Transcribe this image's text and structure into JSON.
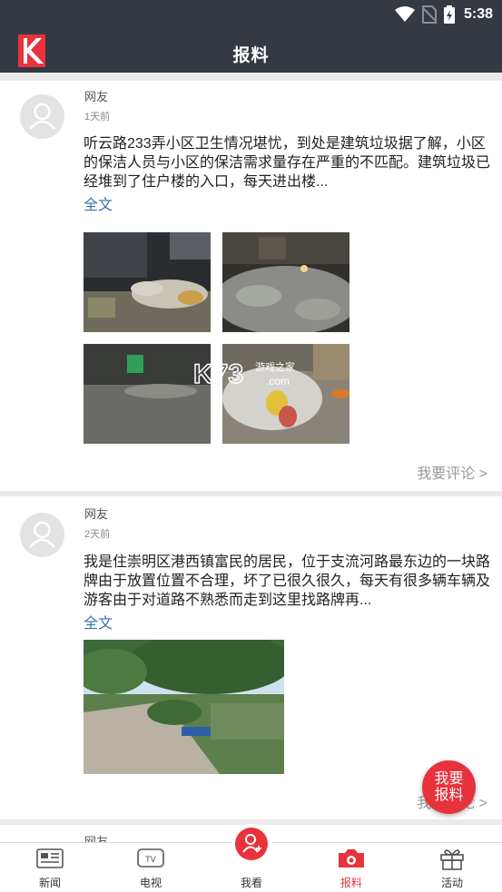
{
  "status_bar": {
    "time": "5:38"
  },
  "header": {
    "title": "报料"
  },
  "posts": [
    {
      "username": "网友",
      "time": "1天前",
      "text": "听云路233弄小区卫生情况堪忧，到处是建筑垃圾据了解，小区的保洁人员与小区的保洁需求量存在严重的不匹配。建筑垃圾已经堆到了住户楼的入口，每天进出楼...",
      "fulltext": "全文",
      "comment": "我要评论 >"
    },
    {
      "username": "网友",
      "time": "2天前",
      "text": "我是住崇明区港西镇富民的居民，位于支流河路最东边的一块路牌由于放置位置不合理，坏了已很久很久，每天有很多辆车辆及游客由于对道路不熟悉而走到这里找路牌再...",
      "fulltext": "全文",
      "comment": "我要评论 >"
    },
    {
      "username": "网友"
    }
  ],
  "watermark": {
    "brand": "K73",
    "tag": "游戏之家",
    "domain": ".com"
  },
  "fab": {
    "line1": "我要",
    "line2": "报料"
  },
  "tabs": [
    {
      "label": "新闻",
      "icon": "newspaper-icon"
    },
    {
      "label": "电视",
      "icon": "tv-icon"
    },
    {
      "label": "我看",
      "icon": "user-plus-icon"
    },
    {
      "label": "报料",
      "icon": "camera-icon"
    },
    {
      "label": "活动",
      "icon": "gift-icon"
    }
  ],
  "colors": {
    "header_bg": "#353a42",
    "accent": "#e8323c",
    "link": "#3a6fb0"
  }
}
